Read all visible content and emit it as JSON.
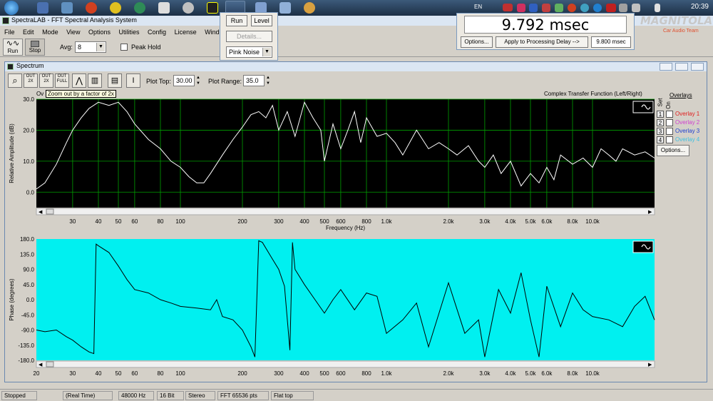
{
  "taskbar": {
    "language": "EN",
    "clock": "20:39"
  },
  "app": {
    "title": "SpectraLAB - FFT Spectral Analysis System"
  },
  "menu": [
    "File",
    "Edit",
    "Mode",
    "View",
    "Options",
    "Utilities",
    "Config",
    "License",
    "Window"
  ],
  "toolbar": {
    "run_label": "Run",
    "stop_label": "Stop",
    "avg_label": "Avg:",
    "avg_value": "8",
    "peak_hold_label": "Peak Hold"
  },
  "run_panel": {
    "run_label": "Run",
    "level_label": "Level",
    "details_label": "Details...",
    "generator": "Pink Noise"
  },
  "delay_panel": {
    "value": "9.792 msec",
    "options_label": "Options...",
    "apply_label": "Apply to Processing Delay -->",
    "processing_delay": "9.800 msec"
  },
  "watermark": {
    "logo": "MAGNITOLA",
    "sub": "Car Audio Team"
  },
  "spectrum_window": {
    "title": "Spectrum",
    "plot_top_label": "Plot Top:",
    "plot_top_value": "30.00",
    "plot_range_label": "Plot Range:",
    "plot_range_value": "35.0",
    "tooltip": "Zoom out by a factor of 2x",
    "tooltip_prefix": "Ov",
    "amp_title": "Complex Transfer Function (Left/Right)",
    "overlays_title": "Overlays",
    "set_label": "Set",
    "on_label": "On",
    "overlays": [
      {
        "num": "1",
        "label": "Overlay 1",
        "color": "#e02020"
      },
      {
        "num": "2",
        "label": "Overlay 2",
        "color": "#d040d0"
      },
      {
        "num": "3",
        "label": "Overlay 3",
        "color": "#2040d0"
      },
      {
        "num": "4",
        "label": "Overlay 4",
        "color": "#40c0e0"
      }
    ],
    "options_label": "Options..."
  },
  "chart_data": [
    {
      "type": "line",
      "title": "Complex Transfer Function (Left/Right)",
      "xlabel": "Frequency (Hz)",
      "ylabel": "Relative Amplitude (dB)",
      "xscale": "log",
      "xlim": [
        20,
        20000
      ],
      "ylim": [
        -5,
        30
      ],
      "xticks": [
        "30",
        "40",
        "50",
        "60",
        "80",
        "100",
        "200",
        "300",
        "400",
        "500",
        "600",
        "800",
        "1.0k",
        "2.0k",
        "3.0k",
        "4.0k",
        "5.0k",
        "6.0k",
        "8.0k",
        "10.0k"
      ],
      "yticks": [
        "30.0",
        "20.0",
        "10.0",
        "0.0"
      ],
      "background": "#000000",
      "line_color": "#ffffff",
      "grid_color": "#00a000",
      "series": [
        {
          "x": [
            20,
            22,
            25,
            28,
            30,
            33,
            36,
            40,
            45,
            50,
            55,
            60,
            70,
            80,
            90,
            100,
            110,
            120,
            130,
            140,
            160,
            180,
            200,
            220,
            240,
            260,
            280,
            300,
            330,
            360,
            400,
            440,
            480,
            500,
            550,
            600,
            650,
            700,
            750,
            800,
            900,
            1000,
            1100,
            1200,
            1400,
            1600,
            1800,
            2000,
            2200,
            2500,
            2800,
            3000,
            3300,
            3600,
            4000,
            4500,
            5000,
            5500,
            6000,
            6500,
            7000,
            8000,
            9000,
            10000,
            11000,
            12000,
            13000,
            14000,
            16000,
            18000,
            20000
          ],
          "y": [
            1,
            3,
            9,
            16,
            20,
            24,
            27,
            29,
            28,
            29,
            26,
            22,
            17,
            14,
            10,
            8,
            5,
            3,
            3,
            6,
            12,
            17,
            21,
            25,
            26,
            24,
            28,
            20,
            26,
            18,
            29,
            24,
            20,
            10,
            22,
            14,
            20,
            26,
            16,
            24,
            18,
            19,
            16,
            12,
            20,
            14,
            16,
            14,
            12,
            15,
            10,
            8,
            12,
            6,
            10,
            2,
            6,
            3,
            8,
            4,
            12,
            9,
            11,
            8,
            14,
            12,
            10,
            14,
            12,
            13,
            11
          ]
        }
      ]
    },
    {
      "type": "line",
      "xlabel": "",
      "ylabel": "Phase (degrees)",
      "xscale": "log",
      "xlim": [
        20,
        20000
      ],
      "ylim": [
        -180,
        180
      ],
      "xticks": [
        "20",
        "30",
        "40",
        "50",
        "60",
        "80",
        "100",
        "200",
        "300",
        "400",
        "500",
        "600",
        "800",
        "1.0k",
        "2.0k",
        "3.0k",
        "4.0k",
        "5.0k",
        "6.0k",
        "8.0k",
        "10.0k"
      ],
      "yticks": [
        "180.0",
        "135.0",
        "90.0",
        "45.0",
        "0.0",
        "-45.0",
        "-90.0",
        "-135.0",
        "-180.0"
      ],
      "background": "#00f0f0",
      "line_color": "#000000",
      "series": [
        {
          "x": [
            20,
            22,
            25,
            28,
            30,
            33,
            36,
            38,
            39,
            40,
            45,
            50,
            55,
            60,
            70,
            80,
            90,
            100,
            120,
            140,
            150,
            160,
            180,
            200,
            220,
            230,
            240,
            250,
            280,
            300,
            320,
            340,
            350,
            360,
            400,
            450,
            500,
            550,
            600,
            700,
            800,
            900,
            1000,
            1200,
            1400,
            1600,
            2000,
            2400,
            2800,
            3000,
            3500,
            4000,
            4500,
            5000,
            5500,
            6000,
            7000,
            8000,
            9000,
            10000,
            12000,
            14000,
            16000,
            18000,
            20000
          ],
          "y": [
            -90,
            -95,
            -90,
            -110,
            -120,
            -140,
            -155,
            -160,
            165,
            160,
            140,
            100,
            60,
            30,
            20,
            0,
            -10,
            -20,
            -25,
            -30,
            0,
            -50,
            -60,
            -90,
            -140,
            -170,
            175,
            170,
            120,
            90,
            40,
            -150,
            170,
            90,
            45,
            0,
            -40,
            0,
            30,
            -30,
            20,
            10,
            -100,
            -60,
            -10,
            -140,
            50,
            -100,
            -60,
            -170,
            30,
            -40,
            80,
            -60,
            -170,
            40,
            -80,
            20,
            -30,
            -50,
            -60,
            -80,
            -20,
            10,
            -60
          ]
        }
      ]
    }
  ],
  "status": {
    "state": "Stopped",
    "mode": "(Real Time)",
    "rate": "48000 Hz",
    "bits": "16 Bit",
    "channels": "Stereo",
    "fft": "FFT 65536 pts",
    "window": "Flat top"
  }
}
